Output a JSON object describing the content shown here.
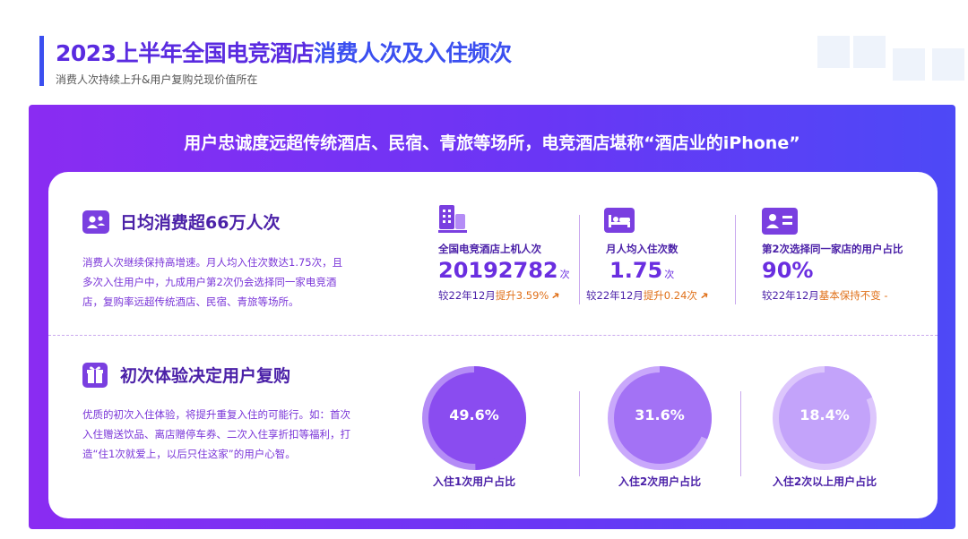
{
  "header": {
    "title_part1": "2023上半年全国电竞酒店",
    "title_part2": "消费人次及入住频次",
    "subtitle": "消费人次持续上升&用户复购兑现价值所在"
  },
  "banner": {
    "text": "用户忠诚度远超传统酒店、民宿、青旅等场所，电竞酒店堪称“酒店业的iPhone”"
  },
  "section1": {
    "icon": "people-icon",
    "title": "日均消费超66万人次",
    "description": "消费人次继续保持高增速。月人均入住次数达1.75次，且多次入住用户中，九成用户第2次仍会选择同一家电竞酒店，复购率远超传统酒店、民宿、青旅等场所。",
    "metrics": [
      {
        "icon": "building-icon",
        "label": "全国电竞酒店上机人次",
        "value": "20192782",
        "unit": "次",
        "compare_prefix": "较22年12月",
        "compare_highlight": "提升3.59%",
        "trend": "up"
      },
      {
        "icon": "bed-icon",
        "label": "月人均入住次数",
        "value": "1.75",
        "unit": "次",
        "compare_prefix": "较22年12月",
        "compare_highlight": "提升0.24次",
        "trend": "up"
      },
      {
        "icon": "id-card-icon",
        "label": "第2次选择同一家店的用户占比",
        "value": "90%",
        "unit": "",
        "compare_prefix": "较22年12月",
        "compare_highlight": "基本保持不变 -",
        "trend": "flat"
      }
    ]
  },
  "section2": {
    "icon": "gift-icon",
    "title": "初次体验决定用户复购",
    "description": "优质的初次入住体验，将提升重复入住的可能行。如：首次入住赠送饮品、离店赠停车券、二次入住享折扣等福利，打造“住1次就爱上，以后只住这家”的用户心智。",
    "donuts": [
      {
        "value": 49.6,
        "display": "49.6%",
        "label": "入住1次用户占比",
        "color": "#8a4cf0",
        "track": "#b48cf6"
      },
      {
        "value": 31.6,
        "display": "31.6%",
        "label": "入住2次用户占比",
        "color": "#a372f5",
        "track": "#c9a8fb"
      },
      {
        "value": 18.4,
        "display": "18.4%",
        "label": "入住2次以上用户占比",
        "color": "#c3a3fa",
        "track": "#dcc6fc"
      }
    ]
  }
}
